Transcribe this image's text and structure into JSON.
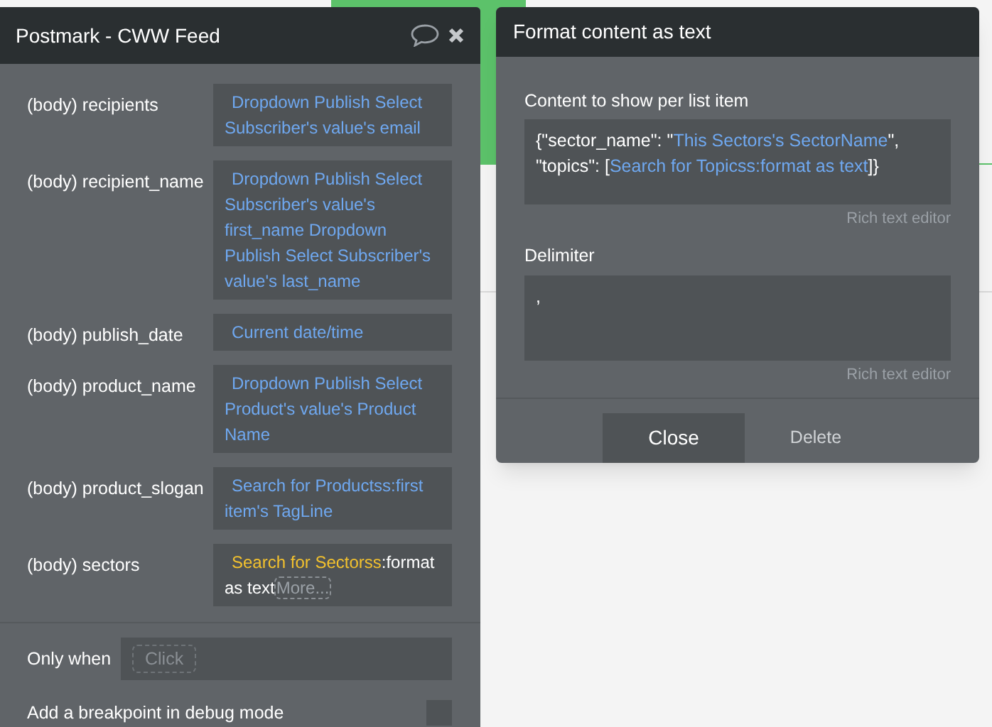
{
  "editor": {
    "title": "Postmark - CWW Feed",
    "fields": [
      {
        "label": "(body) recipients",
        "segments": [
          {
            "kind": "dynamic",
            "text": "Dropdown Publish Select Subscriber's value's email"
          }
        ]
      },
      {
        "label": "(body) recipient_name",
        "segments": [
          {
            "kind": "dynamic",
            "text": "Dropdown Publish Select Subscriber's value's first_name Dropdown Publish Select Subscriber's value's last_name"
          }
        ]
      },
      {
        "label": "(body) publish_date",
        "segments": [
          {
            "kind": "dynamic",
            "text": "Current date/time"
          }
        ]
      },
      {
        "label": "(body) product_name",
        "segments": [
          {
            "kind": "dynamic",
            "text": "Dropdown Publish Select Product's value's Product Name"
          }
        ]
      },
      {
        "label": "(body) product_slogan",
        "segments": [
          {
            "kind": "dynamic",
            "text": "Search for Productss:first item's TagLine"
          }
        ]
      },
      {
        "label": "(body) sectors",
        "segments": [
          {
            "kind": "highlight",
            "text": "Search for Sectorss"
          },
          {
            "kind": "plain",
            "text": ":format as text"
          },
          {
            "kind": "more",
            "text": "More..."
          }
        ]
      }
    ],
    "only_when": {
      "label": "Only when",
      "placeholder": "Click"
    },
    "breakpoint": {
      "label": "Add a breakpoint in debug mode",
      "checked": false
    }
  },
  "dialog": {
    "title": "Format content as text",
    "content": {
      "label": "Content to show per list item",
      "segments": [
        {
          "kind": "plain",
          "text": "{\"sector_name\": \""
        },
        {
          "kind": "dynamic",
          "text": "This Sectors's SectorName"
        },
        {
          "kind": "plain",
          "text": "\", \"topics\": ["
        },
        {
          "kind": "dynamic",
          "text": "Search for Topicss:format as text"
        },
        {
          "kind": "plain",
          "text": "]}"
        }
      ],
      "editor_link": "Rich text editor"
    },
    "delimiter": {
      "label": "Delimiter",
      "value": ",",
      "editor_link": "Rich text editor"
    },
    "buttons": [
      {
        "kind": "primary",
        "label": "Close"
      },
      {
        "kind": "secondary",
        "label": "Delete"
      }
    ]
  }
}
